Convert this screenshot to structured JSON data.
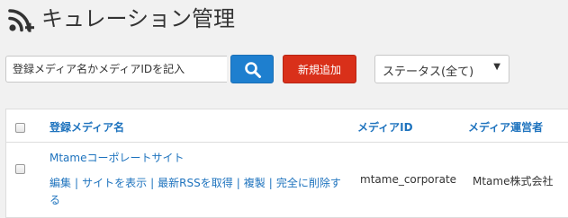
{
  "header": {
    "title": "キュレーション管理",
    "icon": "rss-add-icon"
  },
  "toolbar": {
    "search_placeholder": "登録メディア名かメディアIDを記入",
    "search_icon": "search-icon",
    "add_label": "新規追加",
    "status_value": "ステータス(全て)",
    "status_caret": "▼"
  },
  "table": {
    "columns": {
      "name": "登録メディア名",
      "id": "メディアID",
      "operator": "メディア運営者"
    },
    "rows": [
      {
        "name": "Mtameコーポレートサイト",
        "actions": {
          "edit": "編集",
          "view": "サイトを表示",
          "fetch_rss": "最新RSSを取得",
          "duplicate": "複製",
          "delete": "完全に削除する"
        },
        "media_id": "mtame_corporate",
        "operator": "Mtame株式会社"
      }
    ]
  },
  "colors": {
    "primary_blue": "#1e7fcf",
    "danger_red": "#d9301a",
    "link_blue": "#1e73be",
    "background": "#f1f1f1"
  }
}
